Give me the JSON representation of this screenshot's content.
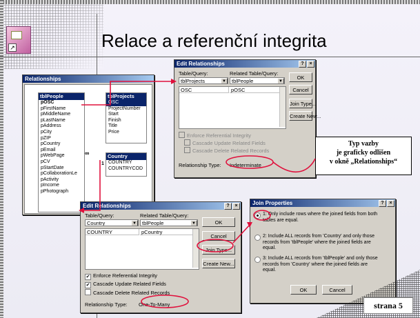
{
  "slide": {
    "title": "Relace  a  referenční integrita",
    "page_label": "strana 5"
  },
  "callout": {
    "line1": "Typ vazby",
    "line2": "je graficky odlišen",
    "line3": "v okně „Relationships“"
  },
  "relationships_window": {
    "title": "Relationships",
    "one_label": "1",
    "many_label": "∞",
    "tblPeople": {
      "name": "tblPeople",
      "fields": [
        "pOSC",
        "pFirstName",
        "pMiddleName",
        "pLastName",
        "pAddress",
        "pCity",
        "pZIP",
        "pCountry",
        "pEmail",
        "pWebPage",
        "pCV",
        "pStartDate",
        "pCollaborationLe",
        "pActivity",
        "pIncome",
        "pPhotograph"
      ]
    },
    "tblProjects": {
      "name": "tblProjects",
      "fields": [
        "OSC",
        "ProjectNumber",
        "Start",
        "Finish",
        "Title",
        "Price"
      ]
    },
    "country": {
      "name": "Country",
      "fields": [
        "COUNTRY",
        "COUNTRYCOD"
      ]
    }
  },
  "edit_rel_top": {
    "title": "Edit Relationships",
    "help_btn": "?",
    "close_btn": "×",
    "table_query_label": "Table/Query:",
    "related_label": "Related Table/Query:",
    "table_value": "tblProjects",
    "related_value": "tblPeople",
    "row_left": "OSC",
    "row_right": "pOSC",
    "enforce_label": "Enforce Referential Integrity",
    "cascade_update_label": "Cascade Update Related Fields",
    "cascade_delete_label": "Cascade Delete Related Records",
    "rel_type_label": "Relationship Type:",
    "rel_type_value": "Indeterminate",
    "ok_btn": "OK",
    "cancel_btn": "Cancel",
    "join_btn": "Join Type...",
    "create_btn": "Create New..."
  },
  "edit_rel_bottom": {
    "title": "Edit Relationships",
    "help_btn": "?",
    "close_btn": "×",
    "table_query_label": "Table/Query:",
    "related_label": "Related Table/Query:",
    "table_value": "Country",
    "related_value": "tblPeople",
    "row_left": "COUNTRY",
    "row_right": "pCountry",
    "enforce_label": "Enforce Referential Integrity",
    "cascade_update_label": "Cascade Update Related Fields",
    "cascade_delete_label": "Cascade Delete Related Records",
    "enforce_checked": true,
    "cascade_update_checked": true,
    "cascade_delete_checked": false,
    "check_mark": "✔",
    "rel_type_label": "Relationship Type:",
    "rel_type_value": "One-To-Many",
    "ok_btn": "OK",
    "cancel_btn": "Cancel",
    "join_btn": "Join Type...",
    "create_btn": "Create New..."
  },
  "join_properties": {
    "title": "Join Properties",
    "help_btn": "?",
    "close_btn": "×",
    "option1_num": "1:",
    "option1_l1": "Only include rows where the joined fields from both",
    "option1_l2": "tables are equal.",
    "option2_num": "2:",
    "option2_l1": "Include ALL records from 'Country' and only those",
    "option2_l2": "records from 'tblPeople' where the joined fields are",
    "option2_l3": "equal.",
    "option3_num": "3:",
    "option3_l1": "Include ALL records from 'tblPeople' and only those",
    "option3_l2": "records from 'Country' where the joined fields are",
    "option3_l3": "equal.",
    "selected_option": 1,
    "ok_btn": "OK",
    "cancel_btn": "Cancel"
  },
  "colors": {
    "accent_red": "#e0103c",
    "titlebar_dark": "#0a246a",
    "titlebar_light": "#a6caf0",
    "dialog_face": "#d4d0c8"
  }
}
